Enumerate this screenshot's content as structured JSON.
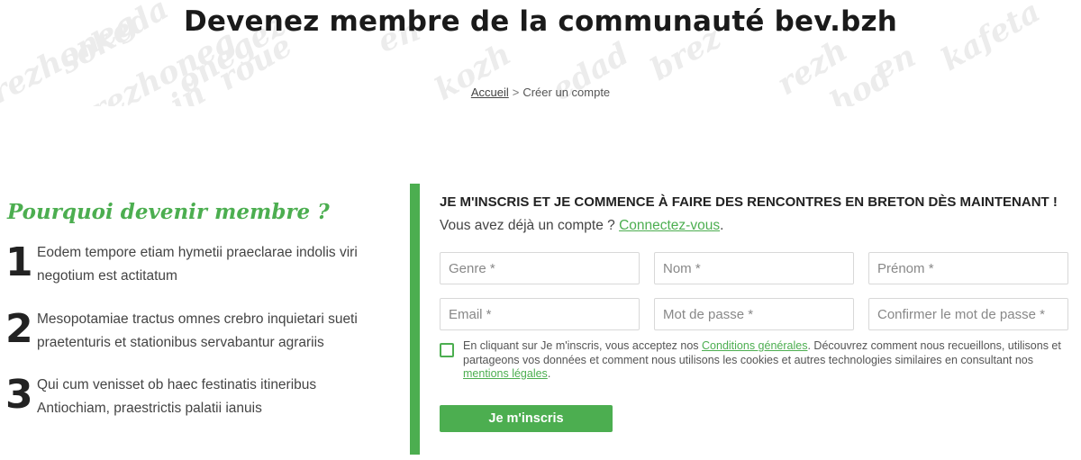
{
  "hero": {
    "title": "Devenez membre de la communauté bev.bzh",
    "watermark_words": [
      "brezhoneg",
      "kafeta",
      "en",
      "hod",
      "rezh",
      "edad",
      "sokeda",
      "iñ",
      "roue",
      "brezhoneg",
      "onegez",
      "kozh",
      "brez",
      "en"
    ]
  },
  "breadcrumb": {
    "home": "Accueil",
    "separator": ">",
    "current": "Créer un compte"
  },
  "why": {
    "title": "Pourquoi devenir membre ?",
    "reasons": [
      {
        "number": "1",
        "text": "Eodem tempore etiam hymetii praeclarae indolis viri negotium est actitatum"
      },
      {
        "number": "2",
        "text": "Mesopotamiae tractus omnes crebro inquietari sueti praetenturis et stationibus servabantur agrariis"
      },
      {
        "number": "3",
        "text": "Qui cum venisset ob haec festinatis itineribus Antiochiam, praestrictis palatii ianuis"
      }
    ]
  },
  "signup": {
    "heading": "JE M'INSCRIS ET JE COMMENCE À FAIRE DES RENCONTRES EN BRETON DÈS MAINTENANT !",
    "login_prompt": "Vous avez déjà un compte ?",
    "login_link": "Connectez-vous",
    "login_suffix": ".",
    "fields": {
      "genre": "Genre *",
      "nom": "Nom *",
      "prenom": "Prénom *",
      "email": "Email *",
      "password": "Mot de passe *",
      "confirm": "Confirmer le mot de passe *"
    },
    "terms": {
      "before": "En cliquant sur Je m'inscris, vous acceptez nos ",
      "conditions_link": "Conditions générales",
      "middle": ". Découvrez comment nous recueillons, utilisons et partageons vos données et comment nous utilisons les cookies et autres technologies similaires en consultant nos ",
      "mentions_link": "mentions légales",
      "after": "."
    },
    "submit_label": "Je m'inscris"
  },
  "colors": {
    "accent": "#4cae50",
    "title": "#1a1a1a",
    "text": "#444444"
  }
}
